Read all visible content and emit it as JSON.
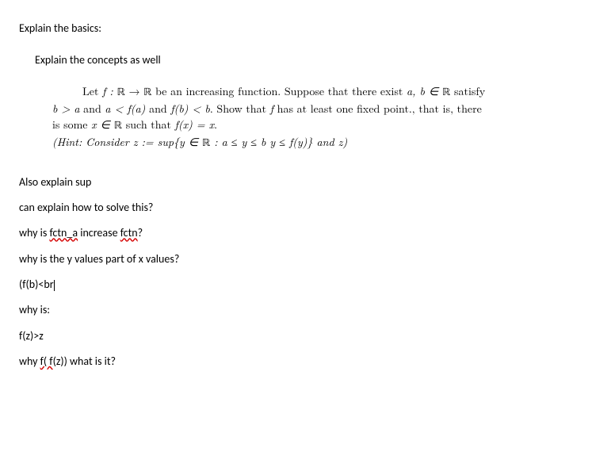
{
  "header1": "Explain the basics:",
  "header2": "Explain the concepts as well",
  "problem": {
    "line1a": "Let ",
    "line1b": "f : ",
    "line1c": " → ",
    "line1d": " be an increasing function. Suppose that there exist ",
    "line1e": "a, b ∈ ",
    "line1f": " satisfy",
    "line2a": "b > a",
    "line2b": " and ",
    "line2c": "a < f(a)",
    "line2d": " and ",
    "line2e": "f(b) < b",
    "line2f": ". Show that ",
    "line2g": "f",
    "line2h": " has at least one fixed point., that is, there",
    "line3a": "is some ",
    "line3b": "x ∈ ",
    "line3c": " such that ",
    "line3d": "f(x) = x",
    "line3e": ".",
    "hint_open": "(Hint: Consider ",
    "hint_expr": "z := sup{y ∈ ",
    "hint_cond": " :  a ≤ y ≤ b y ≤ f(y)}",
    "hint_and": " and ",
    "hint_z": "z",
    "hint_close": ")"
  },
  "R": "ℝ",
  "questions": {
    "q1": "Also explain sup",
    "q2": "can explain how to solve this?",
    "q3a": "why is ",
    "q3b": "fctn_a",
    "q3c": " increase ",
    "q3d": "fctn",
    "q3e": "?",
    "q4": "why is the y values part of x values?",
    "q5": " (f(b)<br",
    "q6": "why is:",
    "q7": "f(z)>z",
    "q8a": "why ",
    "q8b": "f( f",
    "q8c": "(z)) what is it?"
  }
}
